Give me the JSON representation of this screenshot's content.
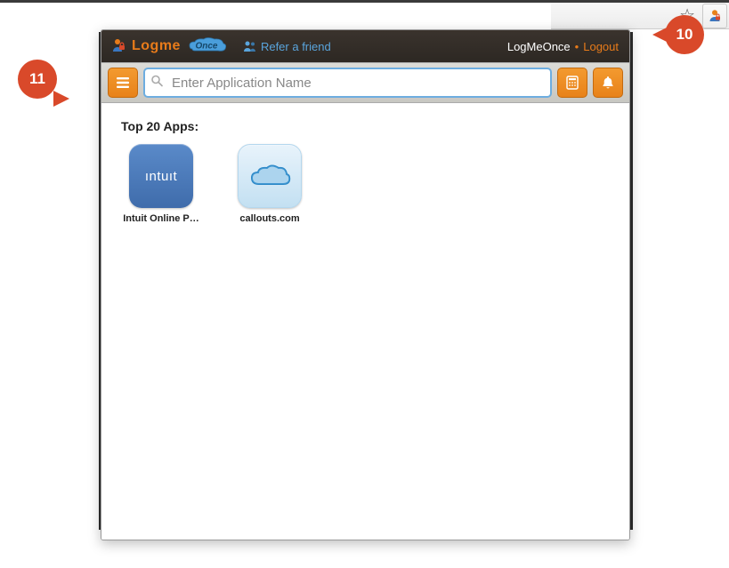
{
  "browser": {
    "star_title": "☆"
  },
  "header": {
    "logo_text_1": "Logme",
    "logo_text_2": "Once",
    "refer_label": "Refer a friend",
    "product_link": "LogMeOnce",
    "logout_label": "Logout"
  },
  "toolbar": {
    "search_placeholder": "Enter Application Name"
  },
  "content": {
    "section_title": "Top 20 Apps:",
    "apps": [
      {
        "label": "Intuit Online P…",
        "icon_text": "ıntuıt"
      },
      {
        "label": "callouts.com"
      }
    ]
  },
  "callouts": {
    "c10": "10",
    "c11": "11"
  },
  "colors": {
    "accent_orange": "#e8821a",
    "callout_red": "#d9492a",
    "link_blue": "#5aa5dd"
  }
}
